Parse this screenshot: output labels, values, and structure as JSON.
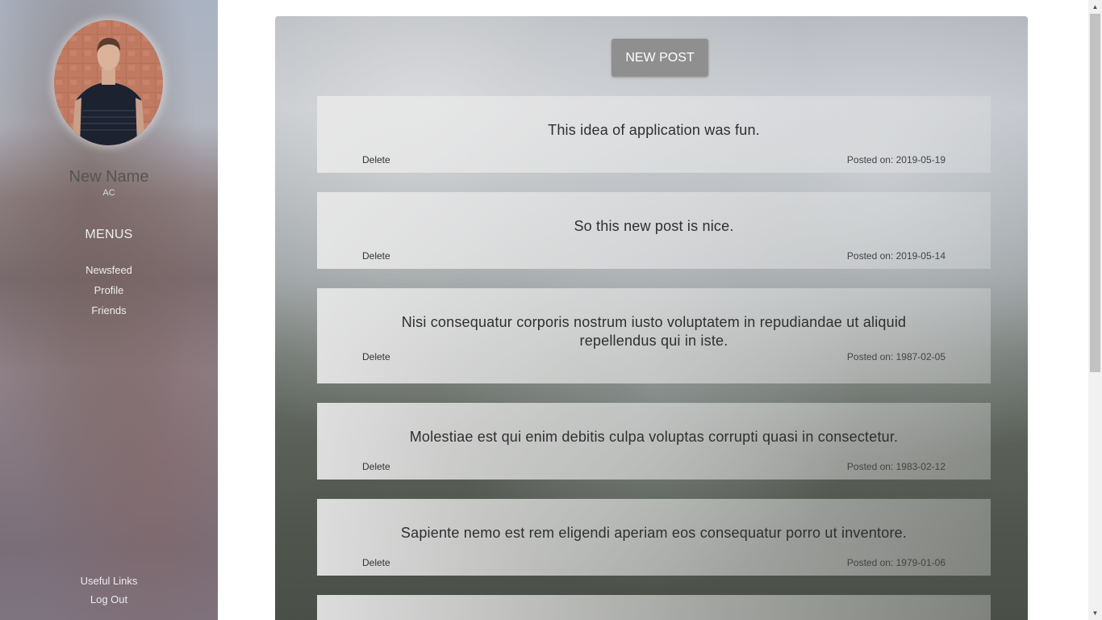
{
  "sidebar": {
    "user": {
      "name": "New Name",
      "initials": "AC"
    },
    "menus_heading": "MENUS",
    "menu_items": [
      {
        "label": "Newsfeed"
      },
      {
        "label": "Profile"
      },
      {
        "label": "Friends"
      }
    ],
    "bottom_links": [
      {
        "label": "Useful Links"
      },
      {
        "label": "Log Out"
      }
    ]
  },
  "feed": {
    "new_post_label": "NEW POST",
    "delete_label": "Delete",
    "posts": [
      {
        "text": "This idea of application was fun.",
        "date": "Posted on: 2019-05-19"
      },
      {
        "text": "So this new post is nice.",
        "date": "Posted on: 2019-05-14"
      },
      {
        "text": "Nisi consequatur corporis nostrum iusto voluptatem in repudiandae ut aliquid repellendus qui in iste.",
        "date": "Posted on: 1987-02-05"
      },
      {
        "text": "Molestiae est qui enim debitis culpa voluptas corrupti quasi in consectetur.",
        "date": "Posted on: 1983-02-12"
      },
      {
        "text": "Sapiente nemo est rem eligendi aperiam eos consequatur porro ut inventore.",
        "date": "Posted on: 1979-01-06"
      }
    ]
  },
  "colors": {
    "button_bg": "#8f8f8f",
    "scrollbar_thumb": "#c1c1c1"
  },
  "icons": {
    "scroll_up": "▲",
    "scroll_down": "▼"
  }
}
